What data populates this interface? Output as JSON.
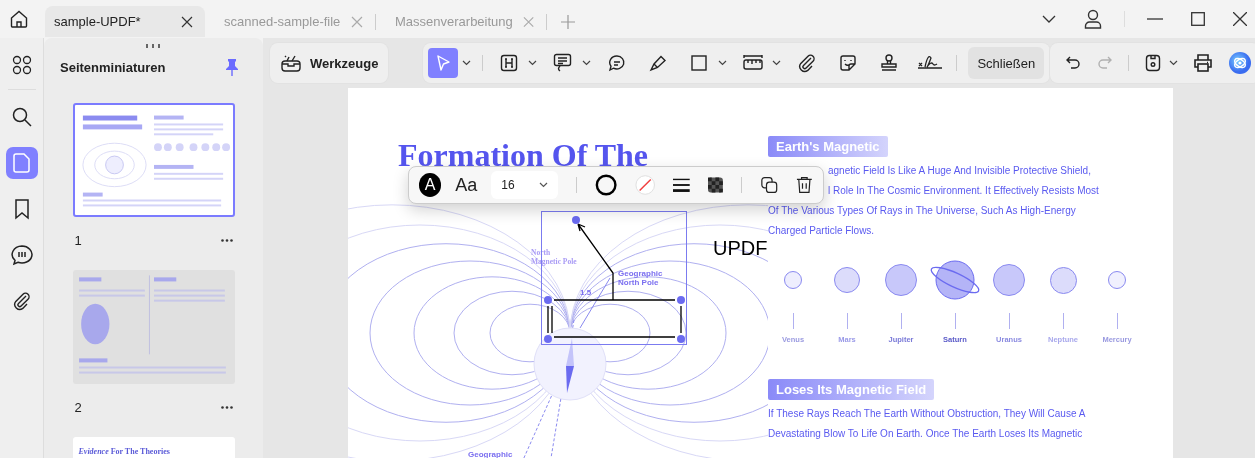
{
  "tabs": [
    {
      "label": "sample-UPDF*",
      "selected": true
    },
    {
      "label": "scanned-sample-file",
      "selected": false
    },
    {
      "label": "Massenverarbeitung",
      "selected": false
    }
  ],
  "rail": [
    {
      "kind": "search",
      "selected": false
    },
    {
      "kind": "pages",
      "selected": true
    },
    {
      "kind": "bookmark",
      "selected": false
    },
    {
      "kind": "comment",
      "selected": false
    },
    {
      "kind": "attachment",
      "selected": false
    }
  ],
  "thumbnail_panel": {
    "title": "Seitenminiaturen",
    "pages": [
      {
        "number": "1",
        "selected": true
      },
      {
        "number": "2",
        "selected": false
      },
      {
        "heading": "*Evidence* For The Theories",
        "selected": false
      }
    ]
  },
  "toolbar": {
    "tools_button": "Werkzeuge",
    "tools": [
      {
        "kind": "select",
        "selected": true,
        "menu": true
      },
      {
        "kind": "heading",
        "selected": false,
        "menu": true
      },
      {
        "kind": "comment",
        "selected": false,
        "menu": true
      },
      {
        "kind": "callout",
        "selected": false,
        "menu": false
      },
      {
        "kind": "pen",
        "selected": false,
        "menu": false
      },
      {
        "kind": "rectangle",
        "selected": false,
        "menu": true
      },
      {
        "kind": "ruler",
        "selected": false,
        "menu": true
      },
      {
        "kind": "paperclip",
        "selected": false,
        "menu": false
      },
      {
        "kind": "sticker",
        "selected": false,
        "menu": false
      },
      {
        "kind": "stamp",
        "selected": false,
        "menu": false
      },
      {
        "kind": "signature",
        "selected": false,
        "menu": false
      }
    ],
    "close_button": "Schließen",
    "actions": [
      {
        "kind": "undo",
        "disabled": false,
        "menu": false
      },
      {
        "kind": "redo",
        "disabled": true,
        "menu": false
      },
      {
        "kind": "save",
        "disabled": false,
        "menu": true
      },
      {
        "kind": "print",
        "disabled": false,
        "menu": false
      },
      {
        "kind": "assistant",
        "disabled": false,
        "menu": false
      }
    ]
  },
  "format_bar": {
    "text_color_glyph": "A",
    "font_glyph": "Aa",
    "font_size": "16"
  },
  "document": {
    "title": [
      "Formation Of The"
    ],
    "diagram_labels": {
      "north_magnetic_pole": [
        "North",
        "Magnetic Pole"
      ],
      "geographic_north_pole": [
        "Geographic",
        "North Pole"
      ],
      "angle": "1.5",
      "geographic_south": "Geographic"
    },
    "stamp_text": "UPDF",
    "sections": [
      {
        "heading": "Earth's Magnetic",
        "lines": [
          {
            "text": "agnetic Field Is Like A Huge And Invisible Protective Shield,",
            "covered": true
          },
          {
            "text": "l Role In The Cosmic Environment. It Effectively Resists Most",
            "covered": true
          },
          {
            "text": "Of The Various Types Of Rays in The Universe, Such As High-Energy"
          },
          {
            "text": "Charged Particle Flows."
          }
        ]
      },
      {
        "heading": "Loses Its Magnetic Field",
        "lines": [
          {
            "text": "If These Rays Reach The Earth Without Obstruction, They Will Cause A"
          },
          {
            "text": "Devastating Blow To Life On Earth. Once The Earth Loses Its Magnetic"
          }
        ]
      }
    ],
    "planets": [
      {
        "name": "Venus",
        "kind": "plain"
      },
      {
        "name": "Mars",
        "kind": "plain"
      },
      {
        "name": "Jupiter",
        "kind": "plain"
      },
      {
        "name": "Saturn",
        "kind": "ringed"
      },
      {
        "name": "Uranus",
        "kind": "plain"
      },
      {
        "name": "Neptune",
        "kind": "plain"
      },
      {
        "name": "Mercury",
        "kind": "plain"
      }
    ]
  }
}
